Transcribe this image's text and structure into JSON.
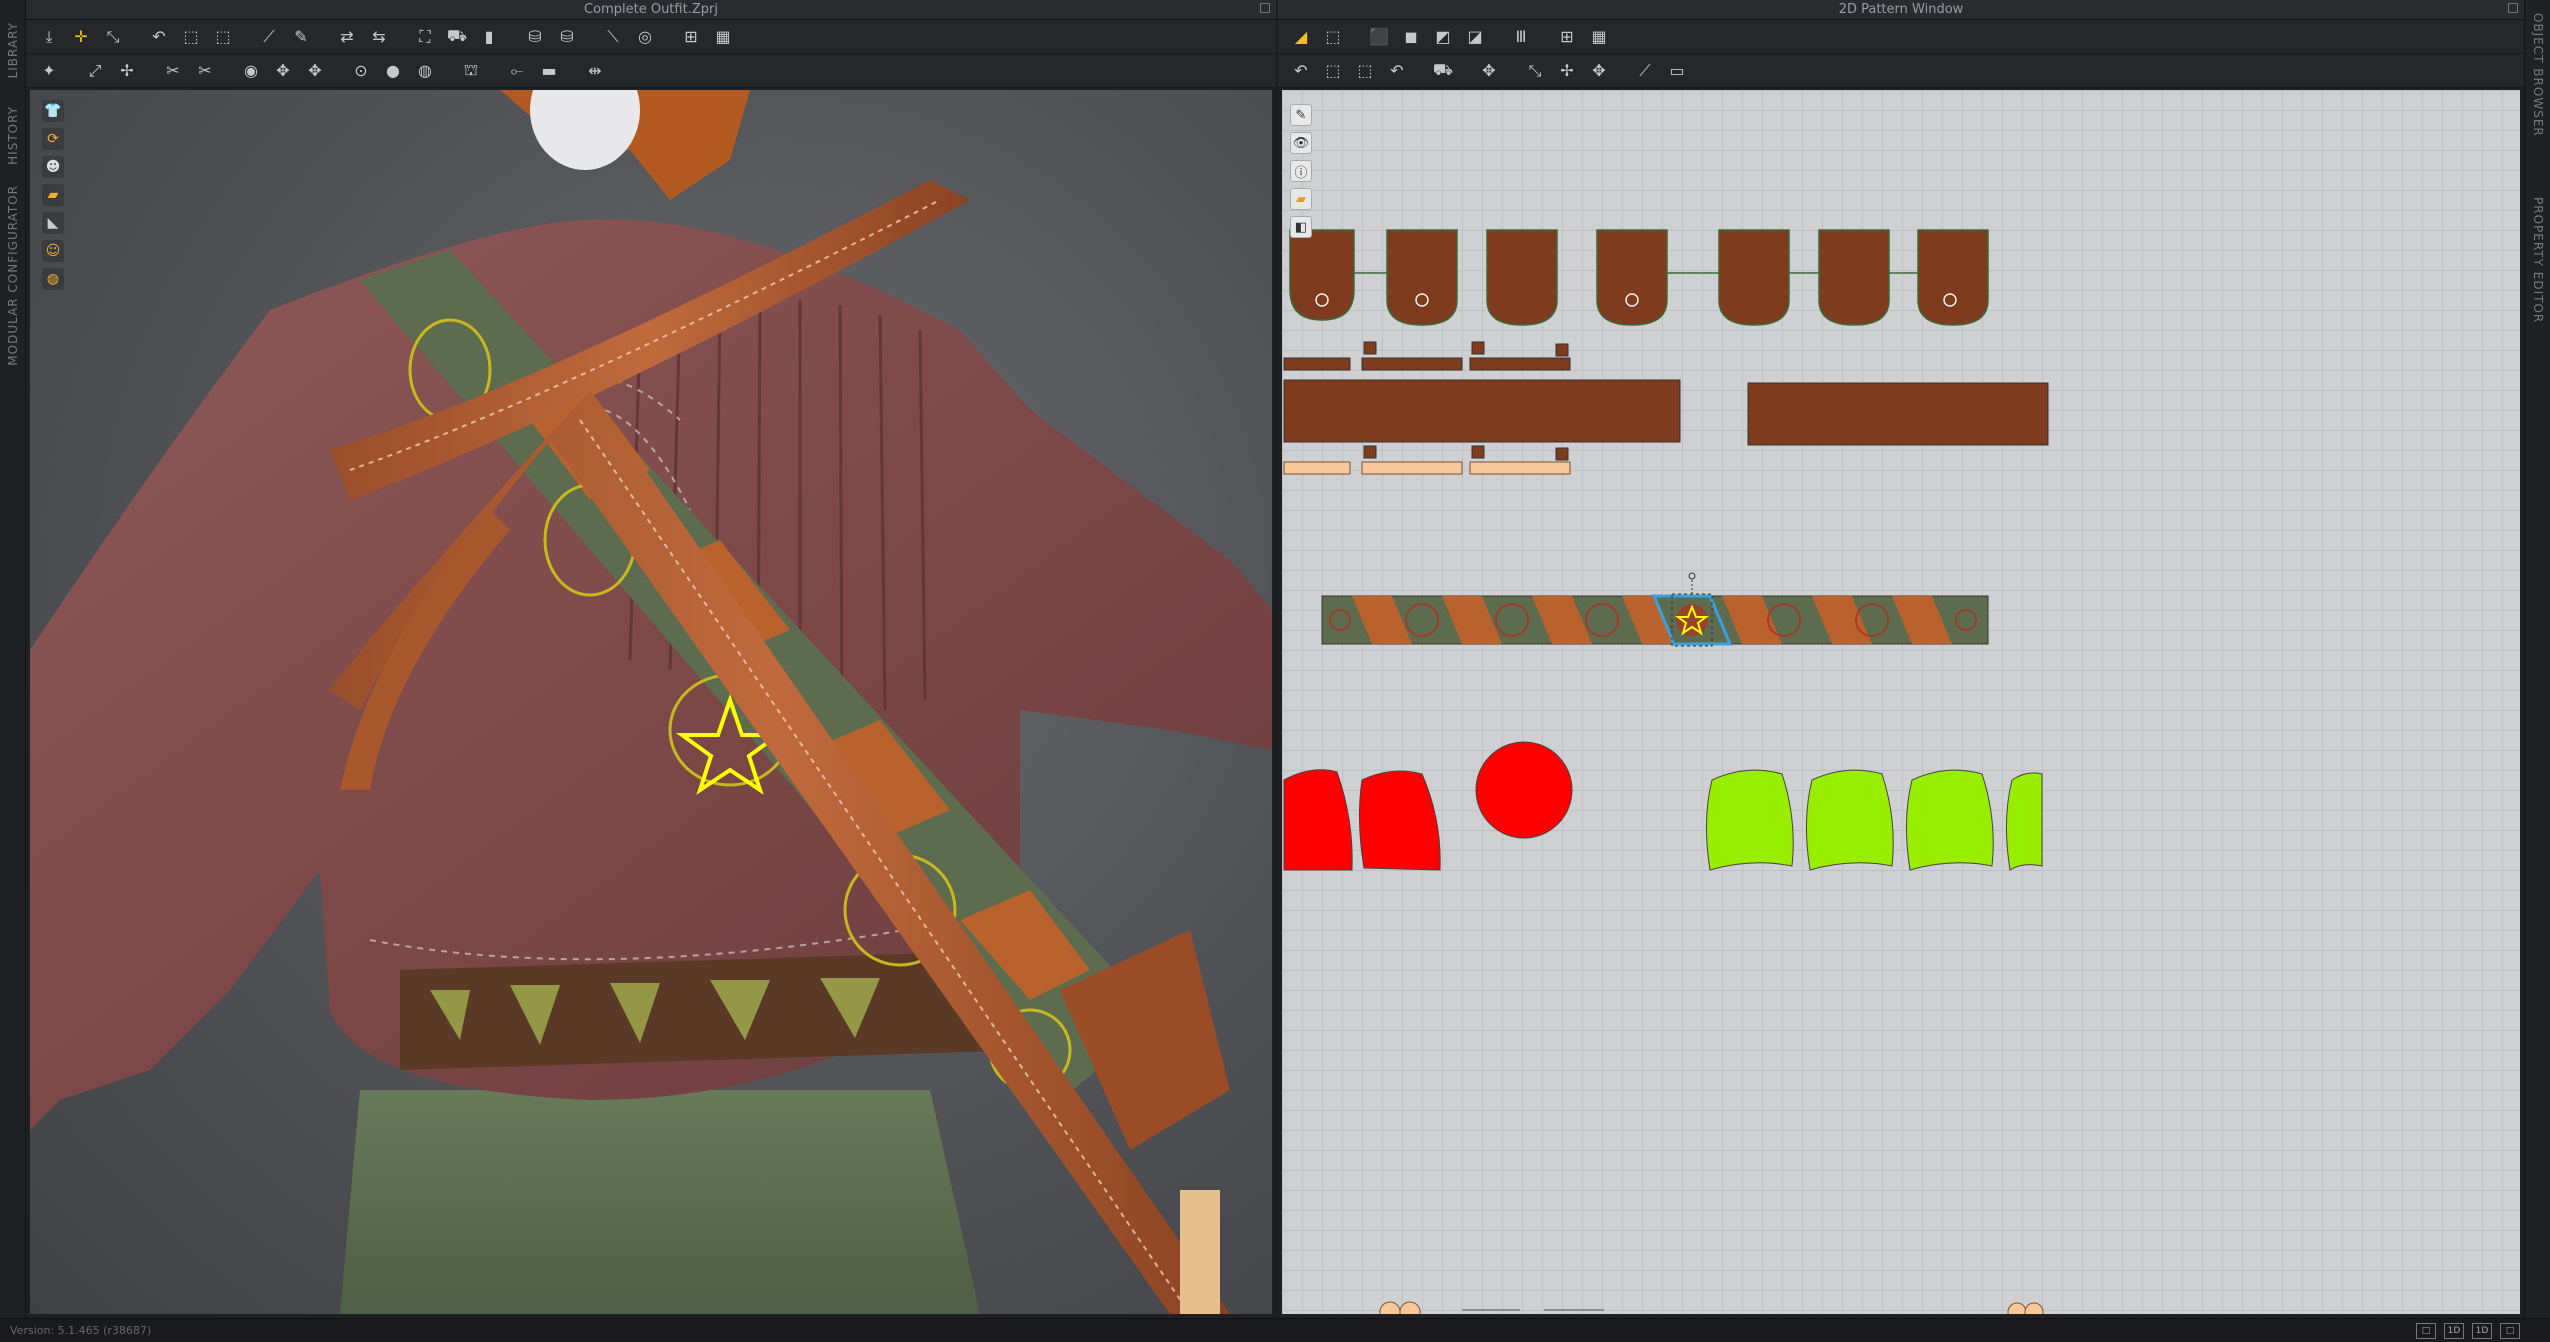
{
  "left_tabs": [
    "LIBRARY",
    "HISTORY",
    "MODULAR CONFIGURATOR"
  ],
  "right_tabs": [
    "OBJECT BROWSER",
    "PROPERTY EDITOR"
  ],
  "window_3d": {
    "title": "Complete Outfit.Zprj"
  },
  "window_2d": {
    "title": "2D Pattern Window"
  },
  "status": {
    "version": "Version: 5.1.465 (r38687)"
  },
  "status_icons": [
    "□",
    "1D",
    "1D",
    "□"
  ],
  "colors": {
    "accent": "#f0c020",
    "fabric_brown": "#7f3b1e",
    "fabric_olive": "#5d6b4f",
    "fabric_red": "#ff0000",
    "fabric_lime": "#99ee00",
    "fabric_peach": "#f8c89a",
    "selection": "#3aa0e0"
  }
}
